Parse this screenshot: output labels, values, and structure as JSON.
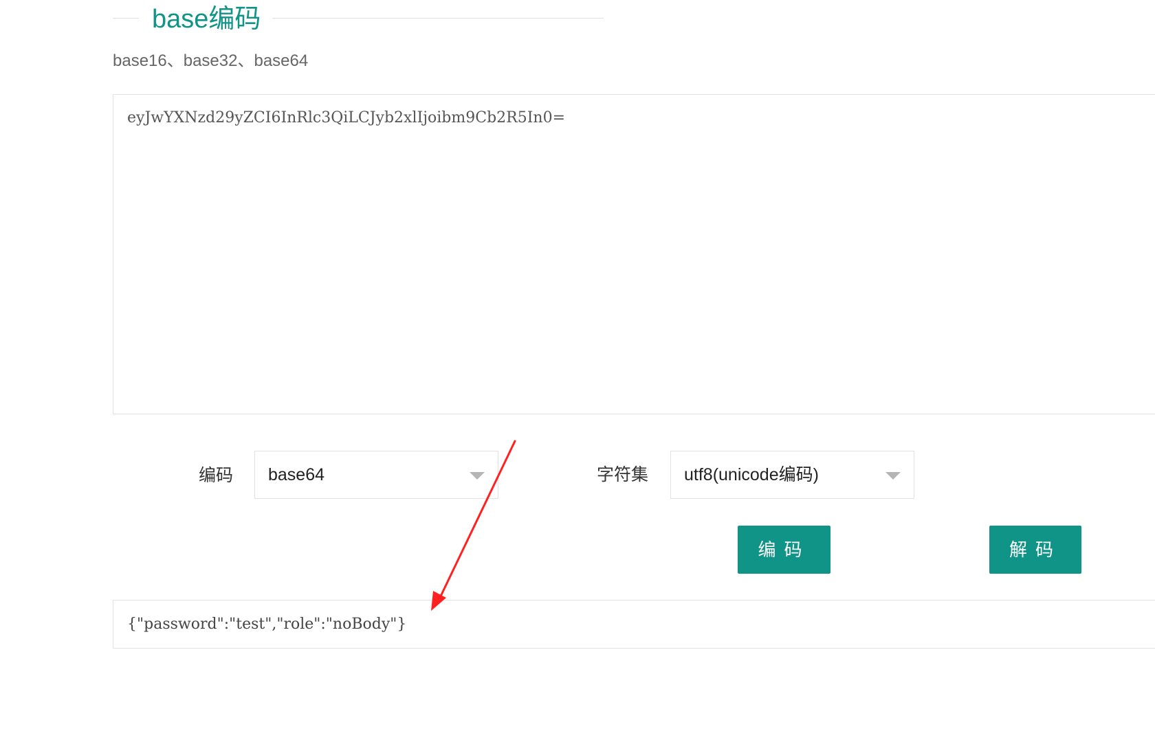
{
  "section": {
    "title": "base编码",
    "subtitle": "base16、base32、base64"
  },
  "input": {
    "value": "eyJwYXNzd29yZCI6InRlc3QiLCJyb2xlIjoibm9Cb2R5In0="
  },
  "controls": {
    "encoding_label": "编码",
    "encoding_value": "base64",
    "charset_label": "字符集",
    "charset_value": "utf8(unicode编码)",
    "encode_button": "编码",
    "decode_button": "解码"
  },
  "output": {
    "value": "{\"password\":\"test\",\"role\":\"noBody\"}"
  },
  "annotation": {
    "arrow_color": "#ff2020"
  },
  "colors": {
    "accent": "#119488",
    "border": "#e2e2e2"
  },
  "icons": {
    "dropdown": "chevron-down-icon",
    "annotation": "red-arrow-icon"
  }
}
